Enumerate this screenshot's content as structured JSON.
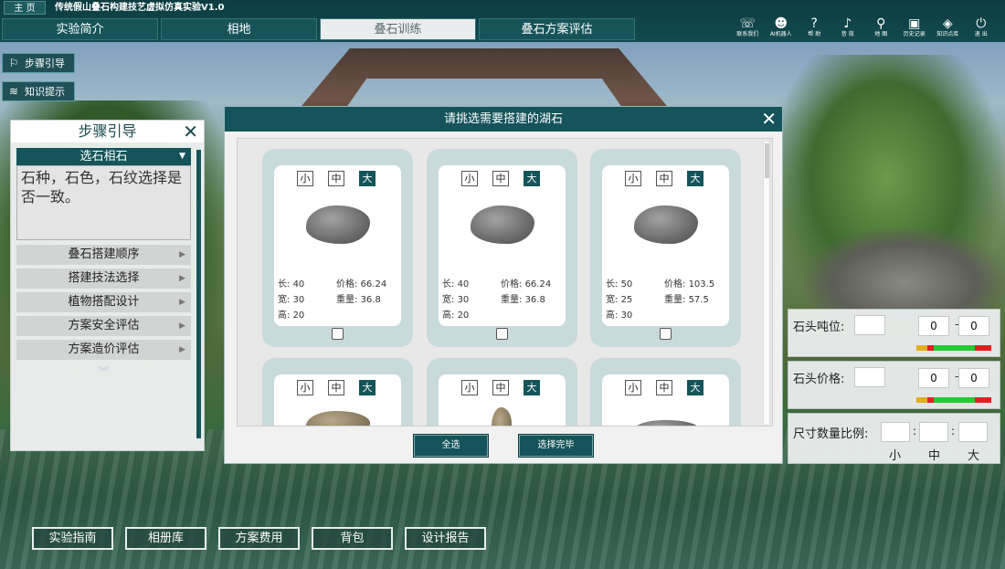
{
  "app": {
    "home_label": "主 页",
    "title": "传统假山叠石构建技艺虚拟仿真实验V1.0"
  },
  "main_tabs": [
    {
      "label": "实验简介"
    },
    {
      "label": "相地"
    },
    {
      "label": "叠石训练"
    },
    {
      "label": "叠石方案评估"
    }
  ],
  "toolbar": [
    {
      "icon": "contact-icon",
      "glyph": "☏",
      "label": "联系我们"
    },
    {
      "icon": "robot-icon",
      "glyph": "☻",
      "label": "AI机器人"
    },
    {
      "icon": "help-icon",
      "glyph": "?",
      "label": "帮 助"
    },
    {
      "icon": "music-icon",
      "glyph": "♪",
      "label": "音 效"
    },
    {
      "icon": "map-icon",
      "glyph": "⚲",
      "label": "地 图"
    },
    {
      "icon": "history-icon",
      "glyph": "▣",
      "label": "历史记录"
    },
    {
      "icon": "knowledge-icon",
      "glyph": "◈",
      "label": "知识点库"
    },
    {
      "icon": "power-icon",
      "glyph": "⏻",
      "label": "退 出"
    }
  ],
  "side_buttons": {
    "step_guide": "步骤引导",
    "knowledge_tip": "知识提示"
  },
  "step_panel": {
    "title": "步骤引导",
    "current_step": "选石相石",
    "description": "石种，石色，石纹选择是否一致。",
    "items": [
      {
        "label": "叠石搭建顺序"
      },
      {
        "label": "搭建技法选择"
      },
      {
        "label": "植物搭配设计"
      },
      {
        "label": "方案安全评估"
      },
      {
        "label": "方案造价评估"
      }
    ]
  },
  "modal": {
    "title": "请挑选需要搭建的湖石",
    "size_labels": [
      "小",
      "中",
      "大"
    ],
    "spec_labels": {
      "length": "长:",
      "width": "宽:",
      "height": "高:",
      "price": "价格:",
      "weight": "重量:"
    },
    "cards": [
      {
        "active_size": "大",
        "length": "40",
        "width": "30",
        "height": "20",
        "price": "66.24",
        "weight": "36.8"
      },
      {
        "active_size": "大",
        "length": "40",
        "width": "30",
        "height": "20",
        "price": "66.24",
        "weight": "36.8"
      },
      {
        "active_size": "大",
        "length": "50",
        "width": "25",
        "height": "30",
        "price": "103.5",
        "weight": "57.5"
      },
      {
        "active_size": "大"
      },
      {
        "active_size": "大"
      },
      {
        "active_size": "大"
      }
    ],
    "select_all": "全选",
    "done": "选择完毕"
  },
  "stats": {
    "tonnage_label": "石头吨位:",
    "tonnage_min": "0",
    "tonnage_max": "0",
    "price_label": "石头价格:",
    "price_min": "0",
    "price_max": "0",
    "ratio_label": "尺寸数量比例:",
    "ratio_sizes": [
      "小",
      "中",
      "大"
    ]
  },
  "bottom_buttons": [
    {
      "label": "实验指南"
    },
    {
      "label": "相册库"
    },
    {
      "label": "方案费用"
    },
    {
      "label": "背包"
    },
    {
      "label": "设计报告"
    }
  ],
  "colors": {
    "primary": "#14545a",
    "meter_yellow": "#e0b020",
    "meter_red": "#e02020",
    "meter_green": "#22cc33"
  }
}
